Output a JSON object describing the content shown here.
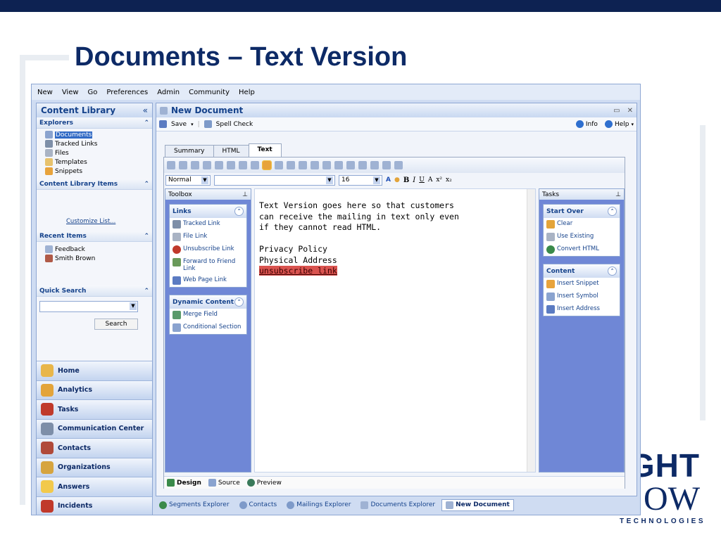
{
  "slide": {
    "title": "Documents – Text Version"
  },
  "logo": {
    "line1": "IGHT",
    "line2": "OW",
    "line3": "TECHNOLOGIES"
  },
  "menu": [
    "New",
    "View",
    "Go",
    "Preferences",
    "Admin",
    "Community",
    "Help"
  ],
  "left_panel": {
    "title": "Content Library",
    "collapse_glyph": "«",
    "explorers": {
      "header": "Explorers",
      "items": [
        {
          "label": "Documents",
          "icon": "documents-icon",
          "selected": true
        },
        {
          "label": "Tracked Links",
          "icon": "tracked-links-icon"
        },
        {
          "label": "Files",
          "icon": "files-icon"
        },
        {
          "label": "Templates",
          "icon": "templates-icon"
        },
        {
          "label": "Snippets",
          "icon": "snippets-icon"
        }
      ]
    },
    "content_library_items": {
      "header": "Content Library Items",
      "link": "Customize List..."
    },
    "recent_items": {
      "header": "Recent Items",
      "items": [
        {
          "label": "Feedback",
          "icon": "document-icon"
        },
        {
          "label": "Smith Brown",
          "icon": "contact-card-icon"
        }
      ]
    },
    "quick_search": {
      "header": "Quick Search",
      "button": "Search"
    },
    "nav": [
      {
        "label": "Home",
        "icon": "home-icon",
        "color": "#e8b64a"
      },
      {
        "label": "Analytics",
        "icon": "analytics-icon",
        "color": "#e3a43a"
      },
      {
        "label": "Tasks",
        "icon": "tasks-icon",
        "color": "#c03a2b"
      },
      {
        "label": "Communication Center",
        "icon": "communication-icon",
        "color": "#7d8ea8"
      },
      {
        "label": "Contacts",
        "icon": "contacts-icon",
        "color": "#b04a3a"
      },
      {
        "label": "Organizations",
        "icon": "organizations-icon",
        "color": "#d6a43f"
      },
      {
        "label": "Answers",
        "icon": "answers-icon",
        "color": "#f2c94c"
      },
      {
        "label": "Incidents",
        "icon": "incidents-icon",
        "color": "#c0392b"
      }
    ]
  },
  "document": {
    "title": "New Document",
    "toolbar": {
      "save": "Save",
      "spell_check": "Spell Check",
      "info": "Info",
      "help": "Help"
    },
    "tabs": [
      {
        "label": "Summary",
        "active": false
      },
      {
        "label": "HTML",
        "active": false
      },
      {
        "label": "Text",
        "active": true
      }
    ],
    "format": {
      "style": "Normal",
      "size": "16"
    },
    "toolbox": {
      "title": "Toolbox",
      "links_card": {
        "header": "Links",
        "items": [
          {
            "label": "Tracked Link",
            "icon": "tracked-link-icon"
          },
          {
            "label": "File Link",
            "icon": "file-link-icon"
          },
          {
            "label": "Unsubscribe Link",
            "icon": "unsubscribe-link-icon"
          },
          {
            "label": "Forward to Friend Link",
            "icon": "forward-friend-icon"
          },
          {
            "label": "Web Page Link",
            "icon": "web-page-link-icon"
          }
        ]
      },
      "dynamic_card": {
        "header": "Dynamic Content",
        "items": [
          {
            "label": "Merge Field",
            "icon": "merge-field-icon"
          },
          {
            "label": "Conditional Section",
            "icon": "conditional-section-icon"
          }
        ]
      }
    },
    "editor": {
      "lines": [
        "Text Version goes here so that customers",
        "can receive the mailing in text only even",
        "if they cannot read HTML.",
        "",
        "Privacy Policy",
        "Physical Address"
      ],
      "highlighted": "unsubscribe link"
    },
    "tasks": {
      "title": "Tasks",
      "start_over": {
        "header": "Start Over",
        "items": [
          {
            "label": "Clear",
            "icon": "clear-icon"
          },
          {
            "label": "Use Existing",
            "icon": "use-existing-icon"
          },
          {
            "label": "Convert HTML",
            "icon": "convert-html-icon"
          }
        ]
      },
      "content": {
        "header": "Content",
        "items": [
          {
            "label": "Insert Snippet",
            "icon": "insert-snippet-icon"
          },
          {
            "label": "Insert Symbol",
            "icon": "insert-symbol-icon"
          },
          {
            "label": "Insert Address",
            "icon": "insert-address-icon"
          }
        ]
      }
    },
    "bottom_tabs": [
      {
        "label": "Design",
        "active": true
      },
      {
        "label": "Source",
        "active": false
      },
      {
        "label": "Preview",
        "active": false
      }
    ]
  },
  "window_tabs": [
    {
      "label": "Segments Explorer",
      "active": false
    },
    {
      "label": "Contacts",
      "active": false
    },
    {
      "label": "Mailings Explorer",
      "active": false
    },
    {
      "label": "Documents Explorer",
      "active": false
    },
    {
      "label": "New Document",
      "active": true
    }
  ]
}
